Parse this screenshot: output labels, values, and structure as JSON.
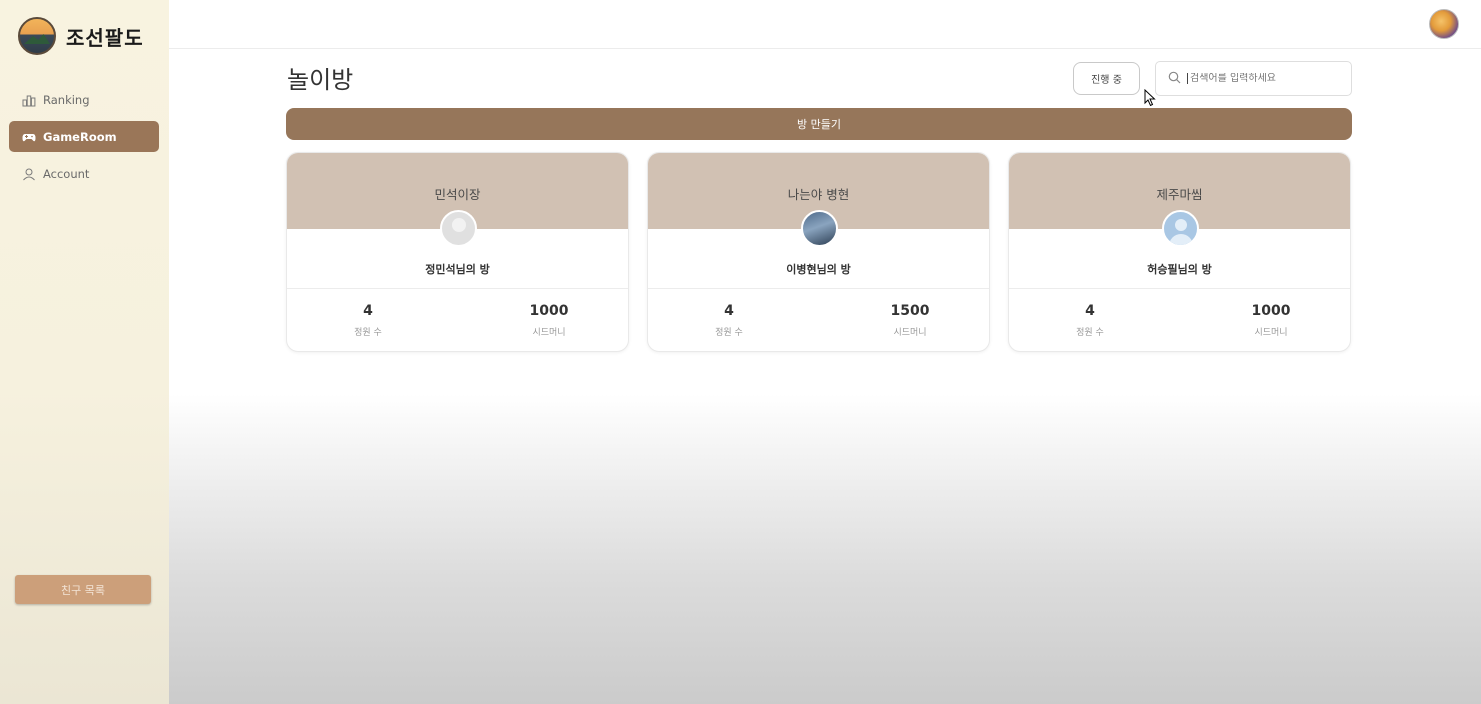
{
  "brand": {
    "name": "조선팔도"
  },
  "sidebar": {
    "items": [
      {
        "label": "Ranking",
        "icon": "ranking-icon",
        "active": false
      },
      {
        "label": "GameRoom",
        "icon": "gamepad-icon",
        "active": true
      },
      {
        "label": "Account",
        "icon": "user-icon",
        "active": false
      }
    ],
    "friends_button": "친구 목록"
  },
  "main": {
    "title": "놀이방",
    "status_button": "진행 중",
    "search_placeholder": "검색어를 입력하세요",
    "create_button": "방 만들기"
  },
  "rooms": [
    {
      "title": "민석이장",
      "room_name": "정민석님의 방",
      "capacity": "4",
      "capacity_label": "정원 수",
      "seed_money": "1000",
      "seed_label": "시드머니"
    },
    {
      "title": "나는야 병현",
      "room_name": "이병현님의 방",
      "capacity": "4",
      "capacity_label": "정원 수",
      "seed_money": "1500",
      "seed_label": "시드머니"
    },
    {
      "title": "제주마씸",
      "room_name": "허승필님의 방",
      "capacity": "4",
      "capacity_label": "정원 수",
      "seed_money": "1000",
      "seed_label": "시드머니"
    }
  ],
  "colors": {
    "accent": "#96765a",
    "card_header": "#d1c1b3",
    "sidebar_bg": "#f8f3e0",
    "friends_button": "#cc9f7a"
  }
}
